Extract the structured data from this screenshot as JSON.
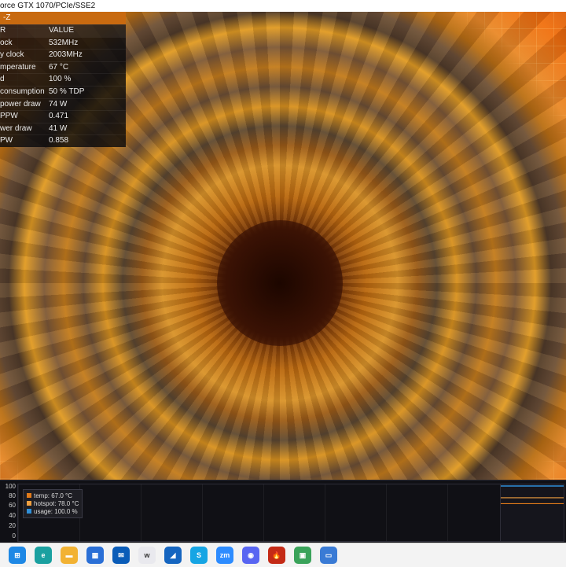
{
  "window": {
    "title": "orce GTX 1070/PCIe/SSE2"
  },
  "overlay": {
    "title": "-Z",
    "header": {
      "col1": "R",
      "col2": "VALUE"
    },
    "rows": [
      {
        "label": "ock",
        "value": "532MHz"
      },
      {
        "label": "y clock",
        "value": "2003MHz"
      },
      {
        "label": "mperature",
        "value": "67 °C"
      },
      {
        "label": "d",
        "value": "100 %"
      },
      {
        "label": "consumption",
        "value": "50 % TDP"
      },
      {
        "label": "power draw",
        "value": "74 W"
      },
      {
        "label": "PPW",
        "value": "0.471"
      },
      {
        "label": "wer draw",
        "value": "41 W"
      },
      {
        "label": "PW",
        "value": "0.858"
      }
    ]
  },
  "graph": {
    "yticks": [
      "100",
      "80",
      "60",
      "40",
      "20",
      "0"
    ],
    "legend": [
      {
        "label": "temp: 67.0 °C",
        "color": "#e07a1a"
      },
      {
        "label": "hotspot: 78.0 °C",
        "color": "#f0a040"
      },
      {
        "label": "usage: 100.0 %",
        "color": "#2f8fd8"
      }
    ],
    "series": {
      "usage": 100,
      "hotspot": 78,
      "temp": 67
    }
  },
  "taskbar": {
    "items": [
      {
        "name": "windows-start-icon",
        "glyph": "⊞",
        "color": "#1e88e5"
      },
      {
        "name": "edge-browser-icon",
        "glyph": "e",
        "color": "#1aa0a0"
      },
      {
        "name": "file-explorer-icon",
        "glyph": "▬",
        "color": "#f2b233"
      },
      {
        "name": "store-icon",
        "glyph": "▦",
        "color": "#2a6fd6"
      },
      {
        "name": "mail-icon",
        "glyph": "✉",
        "color": "#0a5cb8"
      },
      {
        "name": "whatsapp-web-icon",
        "glyph": "w",
        "color": "#e9e9ee"
      },
      {
        "name": "photos-icon",
        "glyph": "◢",
        "color": "#1565c0"
      },
      {
        "name": "skype-icon",
        "glyph": "S",
        "color": "#16a5e4"
      },
      {
        "name": "zoom-icon",
        "glyph": "zm",
        "color": "#2d8cff"
      },
      {
        "name": "discord-icon",
        "glyph": "◉",
        "color": "#5865f2"
      },
      {
        "name": "furmark-icon",
        "glyph": "🔥",
        "color": "#c42a16"
      },
      {
        "name": "gpu-z-icon",
        "glyph": "▣",
        "color": "#3aa35a"
      },
      {
        "name": "active-window-icon",
        "glyph": "▭",
        "color": "#3a7bd5"
      }
    ]
  }
}
